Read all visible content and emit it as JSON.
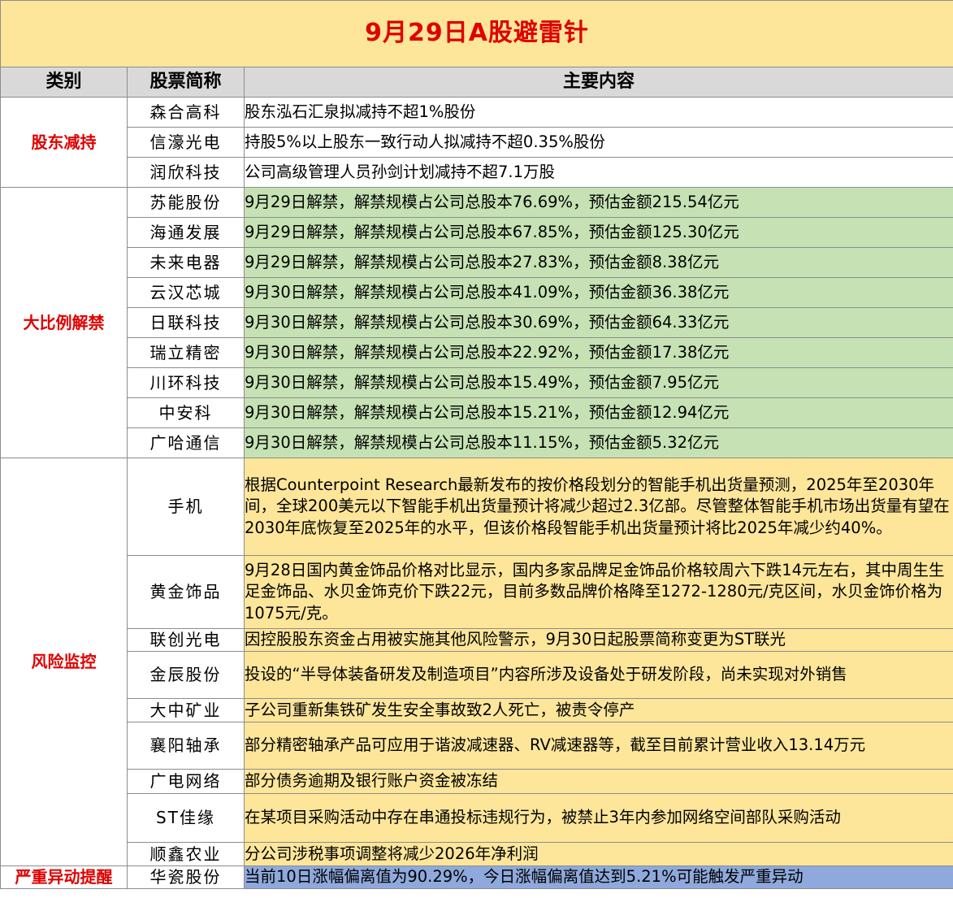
{
  "title": "9月29日A股避雷针",
  "headers": {
    "category": "类别",
    "stock": "股票简称",
    "content": "主要内容"
  },
  "categories": {
    "reduce": "股东减持",
    "unlock": "大比例解禁",
    "risk": "风险监控",
    "abnormal": "严重异动提醒"
  },
  "rows": [
    {
      "name": "森合高科",
      "content": "股东泓石汇泉拟减持不超1%股份"
    },
    {
      "name": "信濠光电",
      "content": "持股5%以上股东一致行动人拟减持不超0.35%股份"
    },
    {
      "name": "润欣科技",
      "content": "公司高级管理人员孙剑计划减持不超7.1万股"
    },
    {
      "name": "苏能股份",
      "content": "9月29日解禁，解禁规模占公司总股本76.69%，预估金额215.54亿元"
    },
    {
      "name": "海通发展",
      "content": "9月29日解禁，解禁规模占公司总股本67.85%，预估金额125.30亿元"
    },
    {
      "name": "未来电器",
      "content": "9月29日解禁，解禁规模占公司总股本27.83%，预估金额8.38亿元"
    },
    {
      "name": "云汉芯城",
      "content": "9月30日解禁，解禁规模占公司总股本41.09%，预估金额36.38亿元"
    },
    {
      "name": "日联科技",
      "content": "9月30日解禁，解禁规模占公司总股本30.69%，预估金额64.33亿元"
    },
    {
      "name": "瑞立精密",
      "content": "9月30日解禁，解禁规模占公司总股本22.92%，预估金额17.38亿元"
    },
    {
      "name": "川环科技",
      "content": "9月30日解禁，解禁规模占公司总股本15.49%，预估金额7.95亿元"
    },
    {
      "name": "中安科",
      "content": "9月30日解禁，解禁规模占公司总股本15.21%，预估金额12.94亿元"
    },
    {
      "name": "广哈通信",
      "content": "9月30日解禁，解禁规模占公司总股本11.15%，预估金额5.32亿元"
    },
    {
      "name": "手机",
      "content": "根据Counterpoint Research最新发布的按价格段划分的智能手机出货量预测，2025年至2030年间，全球200美元以下智能手机出货量预计将减少超过2.3亿部。尽管整体智能手机市场出货量有望在2030年底恢复至2025年的水平，但该价格段智能手机出货量预计将比2025年减少约40%。"
    },
    {
      "name": "黄金饰品",
      "content": "9月28日国内黄金饰品价格对比显示，国内多家品牌足金饰品价格较周六下跌14元左右，其中周生生足金饰品、水贝金饰克价下跌22元，目前多数品牌价格降至1272-1280元/克区间，水贝金饰价格为1075元/克。"
    },
    {
      "name": "联创光电",
      "content": "因控股股东资金占用被实施其他风险警示，9月30日起股票简称变更为ST联光"
    },
    {
      "name": "金辰股份",
      "content": "投设的“半导体装备研发及制造项目”内容所涉及设备处于研发阶段，尚未实现对外销售"
    },
    {
      "name": "大中矿业",
      "content": "子公司重新集铁矿发生安全事故致2人死亡，被责令停产"
    },
    {
      "name": "襄阳轴承",
      "content": "部分精密轴承产品可应用于谐波减速器、RV减速器等，截至目前累计营业收入13.14万元"
    },
    {
      "name": "广电网络",
      "content": "部分债务逾期及银行账户资金被冻结"
    },
    {
      "name": "ST佳缘",
      "content": "在某项目采购活动中存在串通投标违规行为，被禁止3年内参加网络空间部队采购活动"
    },
    {
      "name": "顺鑫农业",
      "content": "分公司涉税事项调整将减少2026年净利润"
    },
    {
      "name": "华瓷股份",
      "content": "当前10日涨幅偏离值为90.29%，今日涨幅偏离值达到5.21%可能触发严重异动"
    }
  ],
  "colors": {
    "title_bg": "#fde69a",
    "title_text": "#e00000",
    "header_bg": "#d9d9d9",
    "unlock_bg": "#c6e2b4",
    "risk_bg": "#fde69a",
    "abnormal_bg": "#8fa9dc"
  }
}
